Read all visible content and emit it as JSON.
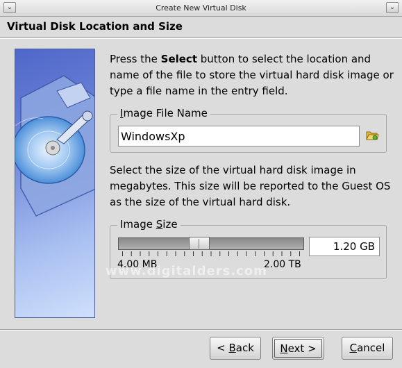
{
  "window": {
    "title": "Create New Virtual Disk",
    "menu_glyph": "⌄",
    "close_glyph": "⌄"
  },
  "header": {
    "title": "Virtual Disk Location and Size"
  },
  "location": {
    "intro_pre": "Press the ",
    "intro_bold": "Select",
    "intro_post": " button to select the location and name of the file to store the virtual hard disk image or type a file name in the entry field.",
    "group_label_mnemonic": "I",
    "group_label_rest": "mage File Name",
    "file_value": "WindowsXp",
    "folder_icon": "folder-open-icon"
  },
  "size": {
    "intro": "Select the size of the virtual hard disk image in megabytes. This size will be reported to the Guest OS as the size of the virtual hard disk.",
    "group_label_pre": "Image ",
    "group_label_mnemonic": "S",
    "group_label_post": "ize",
    "min_label": "4.00 MB",
    "max_label": "2.00 TB",
    "value": "1.20 GB",
    "slider_fraction": 0.43
  },
  "watermark": "www.digitalders.com",
  "buttons": {
    "back_pre": "< ",
    "back_mnemonic": "B",
    "back_post": "ack",
    "next_mnemonic": "N",
    "next_post": "ext >",
    "cancel_mnemonic": "C",
    "cancel_post": "ancel"
  },
  "colors": {
    "sidebar_top": "#4f67c9",
    "sidebar_bottom": "#cfe0fb",
    "window_bg": "#dcdcdc"
  }
}
